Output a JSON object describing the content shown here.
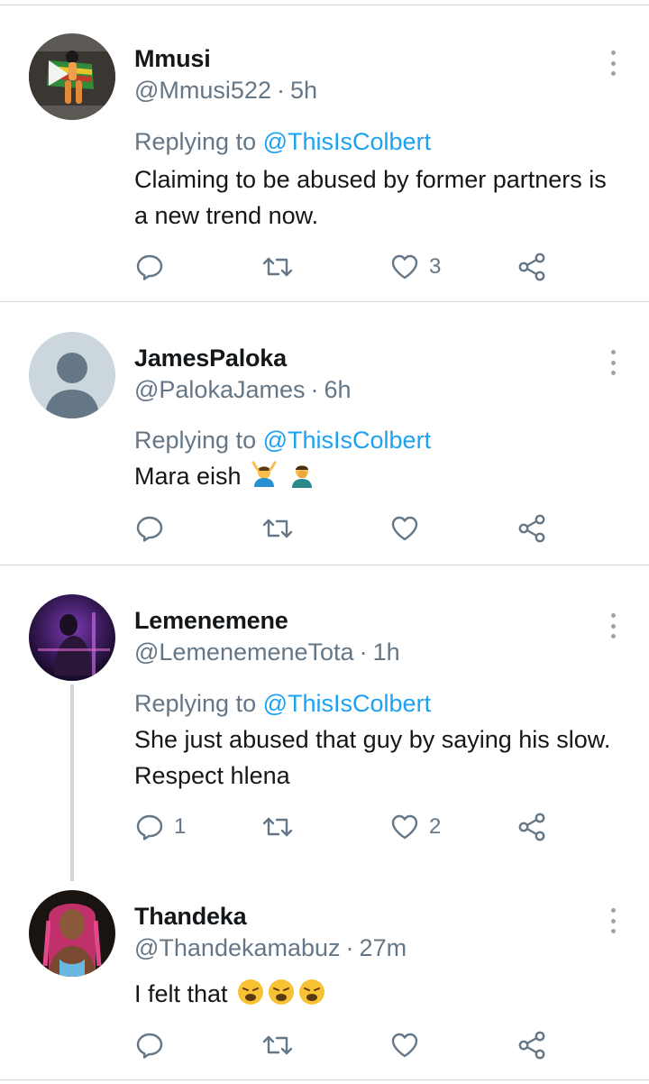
{
  "tweets": [
    {
      "name": "Mmusi",
      "handle": "@Mmusi522",
      "dot": "·",
      "time": "5h",
      "replying_prefix": "Replying to",
      "replying_handle": "@ThisIsColbert",
      "text": "Claiming to be abused by former partners is a new trend now.",
      "reply_count": "",
      "retweet_count": "",
      "like_count": "3"
    },
    {
      "name": "JamesPaloka",
      "handle": "@PalokaJames",
      "dot": "·",
      "time": "6h",
      "replying_prefix": "Replying to",
      "replying_handle": "@ThisIsColbert",
      "text": "Mara eish",
      "reply_count": "",
      "retweet_count": "",
      "like_count": ""
    },
    {
      "name": "Lemenemene",
      "handle": "@LemenemeneTota",
      "dot": "·",
      "time": "1h",
      "replying_prefix": "Replying to",
      "replying_handle": "@ThisIsColbert",
      "text": "She just abused that guy by saying his slow. Respect hlena",
      "reply_count": "1",
      "retweet_count": "",
      "like_count": "2"
    },
    {
      "name": "Thandeka",
      "handle": "@Thandekamabuz",
      "dot": "·",
      "time": "27m",
      "text": "I felt that",
      "reply_count": "",
      "retweet_count": "",
      "like_count": ""
    }
  ],
  "icons": {
    "reply": "reply-icon",
    "retweet": "retweet-icon",
    "like": "heart-icon",
    "share": "share-icon",
    "more": "more-vertical-icon"
  },
  "colors": {
    "link": "#1da1f2",
    "secondary": "#657786",
    "icon": "#657786",
    "divider": "#d5d9dc"
  }
}
